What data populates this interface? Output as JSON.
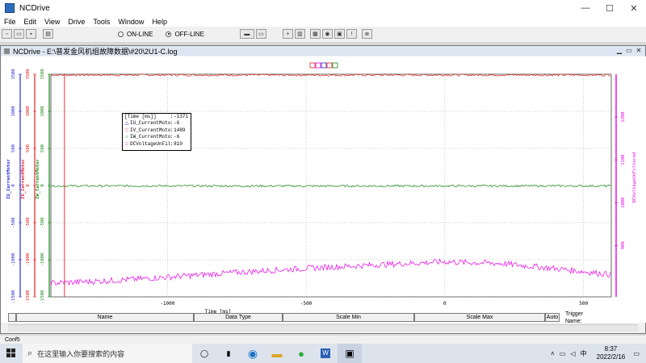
{
  "window": {
    "title": "NCDrive"
  },
  "menu": [
    "File",
    "Edit",
    "View",
    "Drive",
    "Tools",
    "Window",
    "Help"
  ],
  "toolbar": {
    "online_label": "ON-LINE",
    "offline_label": "OFF-LINE",
    "mode": "OFF-LINE"
  },
  "child": {
    "title": "NCDrive - E:\\普发金风机组故障数据\\#20\\2U1-C.log"
  },
  "legend": [
    {
      "marker": "",
      "name": "[Time [ms]]",
      "sep": ":",
      "value": "-1371",
      "color": "#000000"
    },
    {
      "marker": "△",
      "name": "IU_CurrentMotor",
      "sep": ":",
      "value": "-6",
      "color": "#2b2bd6"
    },
    {
      "marker": "□",
      "name": "IV_CurrentMotor",
      "sep": ":",
      "value": "1489",
      "color": "#e02020"
    },
    {
      "marker": "○",
      "name": "IW_CurrentMotor",
      "sep": ":",
      "value": "-6",
      "color": "#1a8a1a"
    },
    {
      "marker": "□",
      "name": "DCVoltageUnFiltered",
      "sep": ":",
      "value": "810",
      "color": "#e800e8"
    }
  ],
  "chart_data": {
    "type": "line",
    "xlabel": "Time [ms]",
    "xticks": [
      -1000,
      -500,
      0,
      500
    ],
    "xlim": [
      -1420,
      600
    ],
    "left_axes": [
      {
        "label": "IU_CurrentMotor",
        "ticks": [
          -1500,
          -1000,
          -500,
          0,
          500,
          1000,
          1500
        ],
        "color": "#2b2bd6"
      },
      {
        "label": "IV_CurrentMotor",
        "ticks": [
          -1500,
          -1000,
          -500,
          0,
          500,
          1000,
          1500
        ],
        "color": "#e02020"
      },
      {
        "label": "IW_CurrentMotor",
        "ticks": [
          -1500,
          -1000,
          -500,
          0,
          500,
          1000,
          1500
        ],
        "color": "#1a8a1a"
      }
    ],
    "ylim": [
      -1500,
      1500
    ],
    "right_axis": {
      "label": "DCVoltageUnFiltered",
      "ticks": [
        900,
        1000,
        1100,
        1200
      ],
      "ylim": [
        780,
        1300
      ],
      "color": "#e800e8"
    },
    "cursor_x": -1371,
    "series": [
      {
        "name": "IV_CurrentMotor",
        "color": "#e02020",
        "x": [
          -1420,
          -1000,
          -500,
          0,
          500,
          600
        ],
        "y": [
          1489,
          1490,
          1488,
          1490,
          1489,
          1490
        ]
      },
      {
        "name": "IW_CurrentMotor",
        "color": "#1a8a1a",
        "x": [
          -1420,
          -1000,
          -500,
          0,
          500,
          600
        ],
        "y": [
          -6,
          -5,
          -7,
          -6,
          -5,
          -6
        ]
      },
      {
        "name": "DCVoltageUnFiltered",
        "color": "#e800e8",
        "x": [
          -1420,
          -1200,
          -1000,
          -800,
          -600,
          -400,
          -200,
          0,
          200,
          400,
          600
        ],
        "y": [
          812,
          818,
          826,
          835,
          843,
          850,
          856,
          862,
          858,
          846,
          832
        ]
      }
    ]
  },
  "table": {
    "headers": [
      "Name",
      "Data Type",
      "Scale Min",
      "Scale Max",
      "Auto"
    ]
  },
  "trigger": {
    "label": "Trigger",
    "name_label": "Name:"
  },
  "status": {
    "text": "Conf5"
  },
  "taskbar": {
    "search_placeholder": "在这里输入你要搜索的内容",
    "time": "8:37",
    "date": "2022/2/16",
    "lang": "中"
  }
}
